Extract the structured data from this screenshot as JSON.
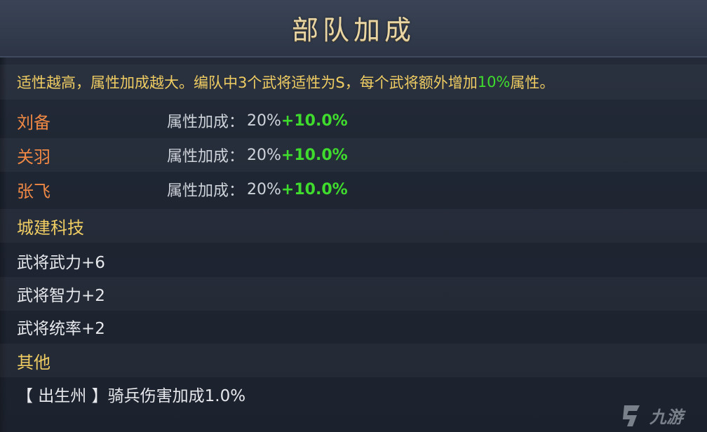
{
  "title": "部队加成",
  "description": {
    "prefix": "适性越高，属性加成越大。编队中3个武将适性为S，每个武将额外增加",
    "highlight": "10%",
    "suffix": "属性。"
  },
  "generals": [
    {
      "name": "刘备",
      "label": "属性加成：",
      "value": "20%",
      "bonus": "+10.0%"
    },
    {
      "name": "关羽",
      "label": "属性加成：",
      "value": "20%",
      "bonus": "+10.0%"
    },
    {
      "name": "张飞",
      "label": "属性加成：",
      "value": "20%",
      "bonus": "+10.0%"
    }
  ],
  "tech": {
    "heading": "城建科技",
    "items": [
      "武将武力+6",
      "武将智力+2",
      "武将统率+2"
    ]
  },
  "other": {
    "heading": "其他",
    "items": [
      "【 出生州 】骑兵伤害加成1.0%"
    ]
  },
  "watermark": {
    "text": "九游",
    "icon": "jiuyou-logo-icon"
  },
  "colors": {
    "title": "#e9d6a4",
    "heading": "#f0cd63",
    "general_name": "#f08845",
    "bonus_green": "#3fdc2e",
    "text": "#e6e8ec"
  }
}
